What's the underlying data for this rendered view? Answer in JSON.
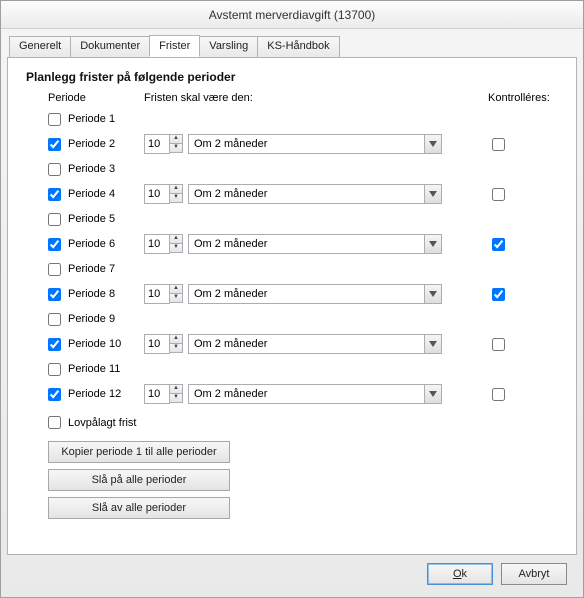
{
  "window": {
    "title": "Avstemt merverdiavgift (13700)"
  },
  "tabs": [
    {
      "label": "Generelt"
    },
    {
      "label": "Dokumenter"
    },
    {
      "label": "Frister"
    },
    {
      "label": "Varsling"
    },
    {
      "label": "KS-Håndbok"
    }
  ],
  "active_tab_index": 2,
  "section_title": "Planlegg frister på følgende perioder",
  "columns": {
    "periode": "Periode",
    "frist": "Fristen skal være den:",
    "kontroll": "Kontrolléres:"
  },
  "rows": [
    {
      "label": "Periode 1",
      "checked": false,
      "day": "",
      "offset": "",
      "kontroll": null
    },
    {
      "label": "Periode 2",
      "checked": true,
      "day": "10",
      "offset": "Om 2 måneder",
      "kontroll": false
    },
    {
      "label": "Periode 3",
      "checked": false,
      "day": "",
      "offset": "",
      "kontroll": null
    },
    {
      "label": "Periode 4",
      "checked": true,
      "day": "10",
      "offset": "Om 2 måneder",
      "kontroll": false
    },
    {
      "label": "Periode 5",
      "checked": false,
      "day": "",
      "offset": "",
      "kontroll": null
    },
    {
      "label": "Periode 6",
      "checked": true,
      "day": "10",
      "offset": "Om 2 måneder",
      "kontroll": true
    },
    {
      "label": "Periode 7",
      "checked": false,
      "day": "",
      "offset": "",
      "kontroll": null
    },
    {
      "label": "Periode 8",
      "checked": true,
      "day": "10",
      "offset": "Om 2 måneder",
      "kontroll": true
    },
    {
      "label": "Periode 9",
      "checked": false,
      "day": "",
      "offset": "",
      "kontroll": null
    },
    {
      "label": "Periode 10",
      "checked": true,
      "day": "10",
      "offset": "Om 2 måneder",
      "kontroll": false
    },
    {
      "label": "Periode 11",
      "checked": false,
      "day": "",
      "offset": "",
      "kontroll": null
    },
    {
      "label": "Periode 12",
      "checked": true,
      "day": "10",
      "offset": "Om 2 måneder",
      "kontroll": false
    }
  ],
  "lovpaalagt": {
    "label": "Lovpålagt frist",
    "checked": false
  },
  "buttons": {
    "copy_all": "Kopier periode 1 til alle perioder",
    "enable_all": "Slå på alle perioder",
    "disable_all": "Slå av alle perioder",
    "ok_letter": "O",
    "ok_rest": "k",
    "cancel": "Avbryt"
  }
}
